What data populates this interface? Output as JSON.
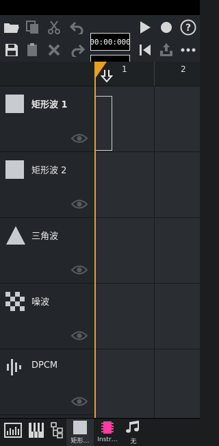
{
  "toolbar": {
    "time_display": "00:00:000"
  },
  "header": {
    "patterns": [
      "1",
      "2"
    ]
  },
  "channels": [
    {
      "name": "矩形波 1",
      "icon": "square-wave-icon"
    },
    {
      "name": "矩形波 2",
      "icon": "square-wave-icon"
    },
    {
      "name": "三角波",
      "icon": "triangle-wave-icon"
    },
    {
      "name": "噪波",
      "icon": "noise-icon"
    },
    {
      "name": "DPCM",
      "icon": "dpcm-icon"
    }
  ],
  "bottom": {
    "tabs": [
      {
        "label": "矩形…",
        "icon": "square-instrument-icon"
      },
      {
        "label": "Instr…",
        "icon": "chip-instrument-icon"
      },
      {
        "label": "无",
        "icon": "music-notes-icon"
      }
    ]
  },
  "colors": {
    "playhead": "#e8a020",
    "accent_pink": "#ff3aa0",
    "panel": "#23272b"
  }
}
